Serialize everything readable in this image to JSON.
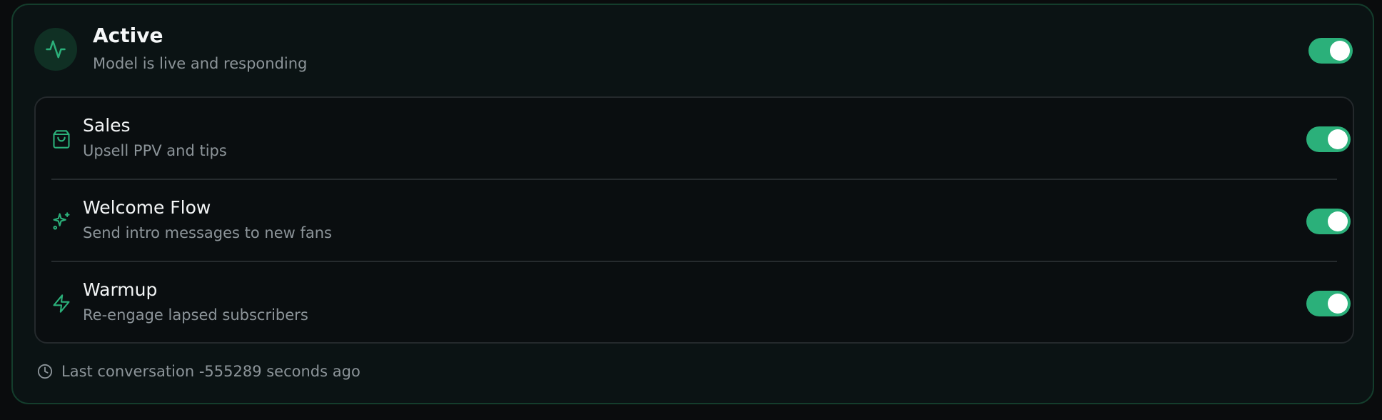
{
  "status": {
    "icon": "activity-icon",
    "title": "Active",
    "subtitle": "Model is live and responding",
    "enabled": true
  },
  "features": [
    {
      "icon": "shopping-bag-icon",
      "title": "Sales",
      "subtitle": "Upsell PPV and tips",
      "enabled": true
    },
    {
      "icon": "sparkles-icon",
      "title": "Welcome Flow",
      "subtitle": "Send intro messages to new fans",
      "enabled": true
    },
    {
      "icon": "zap-icon",
      "title": "Warmup",
      "subtitle": "Re-engage lapsed subscribers",
      "enabled": true
    }
  ],
  "footer": {
    "icon": "clock-icon",
    "text": "Last conversation -555289 seconds ago"
  },
  "colors": {
    "accent": "#2bb07a",
    "card_border": "#143d2c",
    "background": "#0a0c0d"
  }
}
